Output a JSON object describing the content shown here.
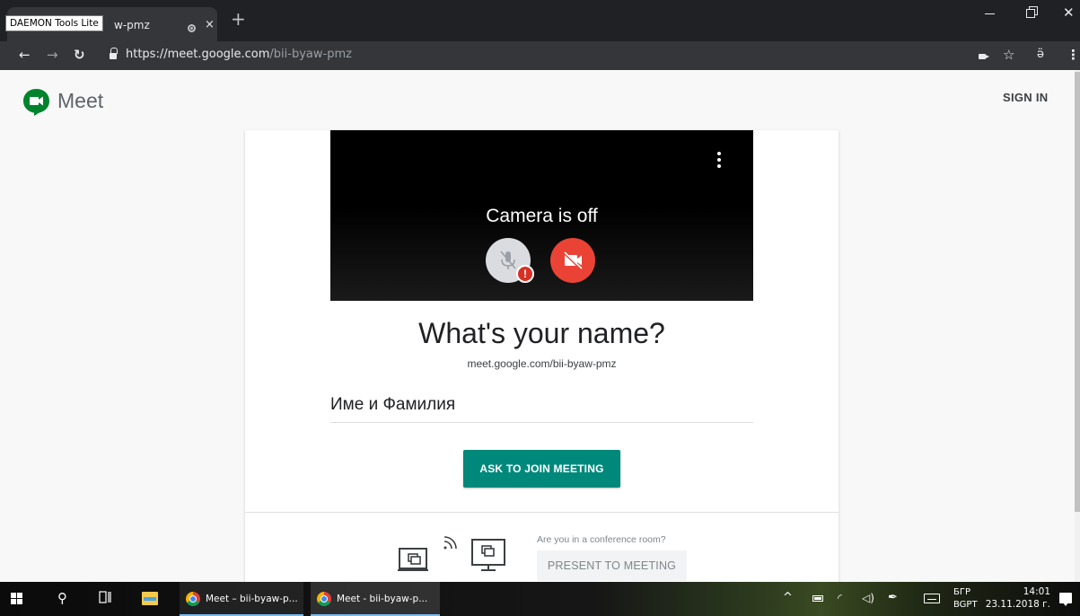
{
  "browser": {
    "tab": {
      "tooltip": "DAEMON Tools Lite",
      "title": "w-pmz",
      "close_glyph": "×"
    },
    "new_tab_glyph": "+",
    "url_scheme": "https://",
    "url_host": "meet.google.com",
    "url_path": "/bii-byaw-pmz",
    "icons": [
      "back-arrow-icon",
      "forward-arrow-icon",
      "reload-icon",
      "lock-icon",
      "camera-icon",
      "star-icon",
      "extension-icon",
      "menu-icon"
    ]
  },
  "meet": {
    "brand": "Meet",
    "sign_in": "SIGN IN",
    "preview": {
      "status": "Camera is off"
    },
    "prompt": "What's your name?",
    "meeting_link": "meet.google.com/bii-byaw-pmz",
    "name_value": "Име и Фамилия",
    "join_button": "ASK TO JOIN MEETING",
    "conference_question": "Are you in a conference room?",
    "present_button": "PRESENT TO MEETING",
    "colors": {
      "join_button": "#00897b",
      "camera_off_button": "#ea4335",
      "mic_alert": "#d93025",
      "logo_green": "#00832d"
    }
  },
  "taskbar": {
    "apps": [
      {
        "label": "Meet – bii-byaw-p..."
      },
      {
        "label": "Meet - bii-byaw-p..."
      }
    ],
    "language_top": "БГР",
    "language_bottom": "BGPT",
    "time": "14:01",
    "date": "23.11.2018 г."
  }
}
